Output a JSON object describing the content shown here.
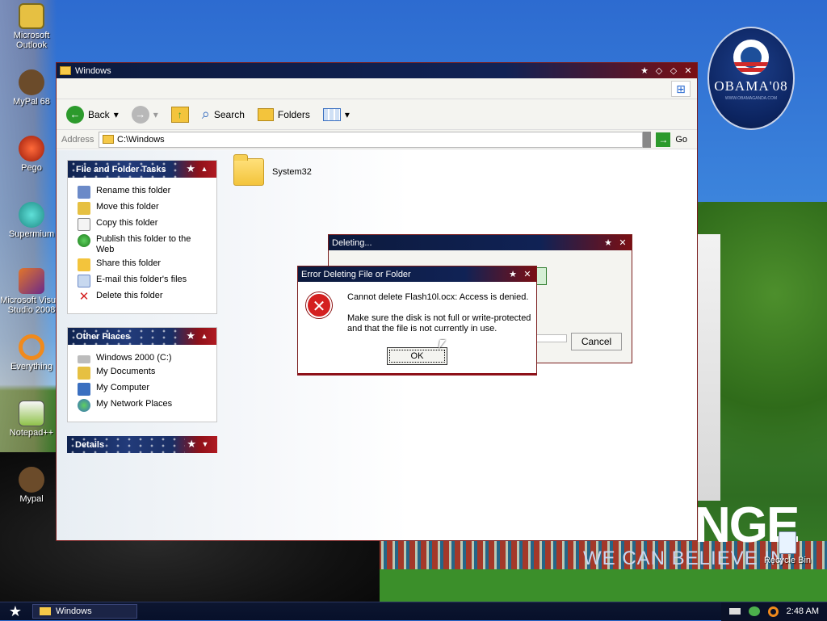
{
  "desktop": {
    "icons": [
      {
        "label": "Microsoft Outlook",
        "color": "#e6c042"
      },
      {
        "label": "MyPal 68",
        "color": "#6b4b2a"
      },
      {
        "label": "Pego",
        "color": "#c2381e"
      },
      {
        "label": "Supermium",
        "color": "#2fa7a0"
      },
      {
        "label": "Microsoft Visual Studio 2008",
        "color": "#e2752a"
      },
      {
        "label": "Everything",
        "color": "#f08a1c"
      },
      {
        "label": "Notepad++",
        "color": "#8fc24a"
      },
      {
        "label": "Mypal",
        "color": "#6b4b2a"
      }
    ],
    "recycle_bin": "Recycle Bin",
    "wallpaper": {
      "badge_text": "OBAMA'08",
      "badge_url": "WWW.OBAMAGANDA.COM",
      "banner": "NGE",
      "banner_sub": "WE CAN BELIEVE IN"
    }
  },
  "window": {
    "title": "Windows",
    "toolbar": {
      "back": "Back",
      "search": "Search",
      "folders": "Folders"
    },
    "address": {
      "label": "Address",
      "value": "C:\\Windows",
      "go": "Go"
    },
    "panels": {
      "tasks": {
        "title": "File and Folder Tasks",
        "items": [
          "Rename this folder",
          "Move this folder",
          "Copy this folder",
          "Publish this folder to the Web",
          "Share this folder",
          "E-mail this folder's files",
          "Delete this folder"
        ]
      },
      "places": {
        "title": "Other Places",
        "items": [
          "Windows 2000 (C:)",
          "My Documents",
          "My Computer",
          "My Network Places"
        ]
      },
      "details": {
        "title": "Details"
      }
    },
    "items": [
      {
        "name": "System32"
      }
    ]
  },
  "dialogs": {
    "deleting": {
      "title": "Deleting...",
      "cancel": "Cancel"
    },
    "error": {
      "title": "Error Deleting File or Folder",
      "message": "Cannot delete Flash10l.ocx: Access is denied.",
      "detail": "Make sure the disk is not full or write-protected and that the file is not currently in use.",
      "ok": "OK"
    }
  },
  "taskbar": {
    "task": "Windows",
    "clock": "2:48 AM"
  },
  "colors": {
    "titlebar_navy": "#0c1a3d",
    "titlebar_red": "#7a0f14",
    "error_red": "#d42020"
  }
}
